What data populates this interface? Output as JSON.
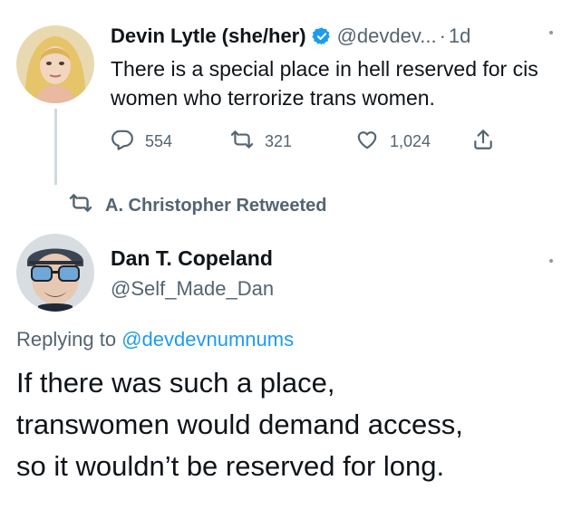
{
  "tweet1": {
    "display_name": "Devin Lytle (she/her)",
    "handle": "@devdev...",
    "separator": "·",
    "time": "1d",
    "text": "There is a special place in hell reserved for cis women who terrorize trans women.",
    "reply_count": "554",
    "retweet_count": "321",
    "like_count": "1,024"
  },
  "retweet_banner": {
    "label": "A. Christopher Retweeted"
  },
  "tweet2": {
    "display_name": "Dan T. Copeland",
    "handle": "@Self_Made_Dan",
    "replying_prefix": "Replying to",
    "replying_to": "@devdevnumnums",
    "text_lines": [
      "If there was such a place,",
      "transwomen would demand access,",
      "so it wouldn’t be reserved for long."
    ]
  },
  "colors": {
    "text_primary": "#0f1419",
    "text_secondary": "#536471",
    "accent_blue": "#1d9bf0"
  },
  "icons": [
    "verified-badge-icon",
    "reply-icon",
    "retweet-icon",
    "like-icon",
    "share-icon",
    "more-icon"
  ]
}
